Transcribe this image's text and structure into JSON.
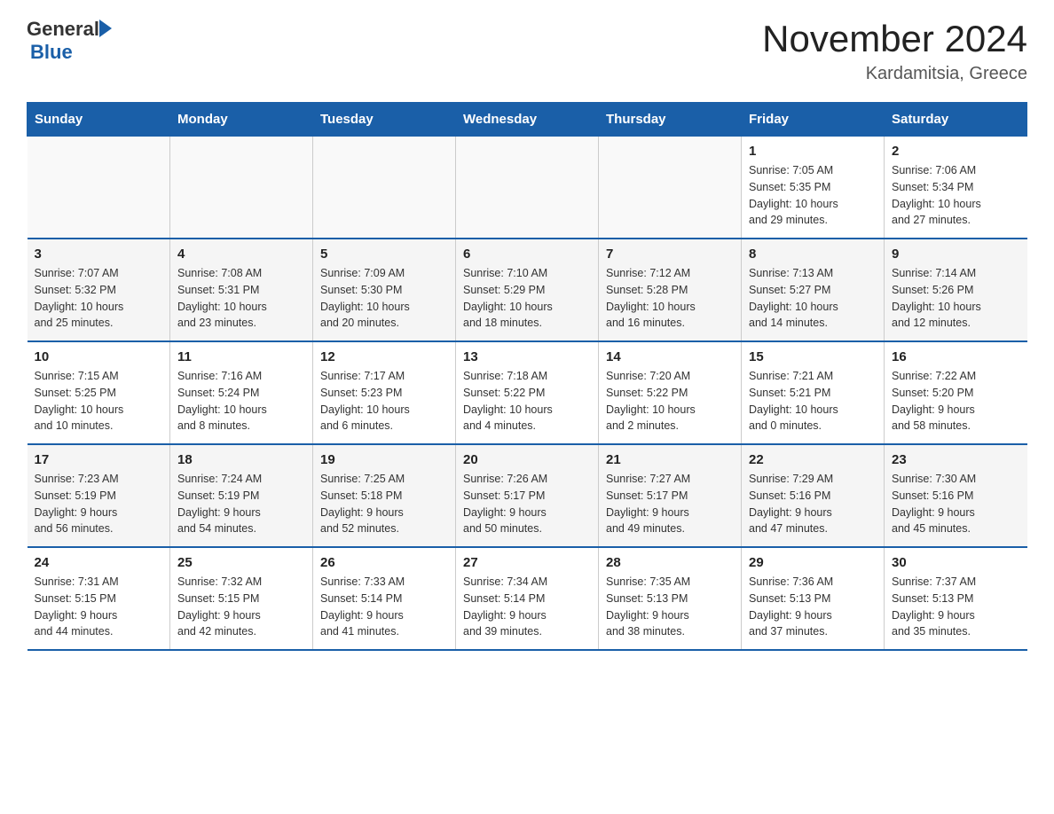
{
  "header": {
    "logo_general": "General",
    "logo_blue": "Blue",
    "title": "November 2024",
    "subtitle": "Kardamitsia, Greece"
  },
  "weekdays": [
    "Sunday",
    "Monday",
    "Tuesday",
    "Wednesday",
    "Thursday",
    "Friday",
    "Saturday"
  ],
  "weeks": [
    [
      {
        "day": "",
        "info": ""
      },
      {
        "day": "",
        "info": ""
      },
      {
        "day": "",
        "info": ""
      },
      {
        "day": "",
        "info": ""
      },
      {
        "day": "",
        "info": ""
      },
      {
        "day": "1",
        "info": "Sunrise: 7:05 AM\nSunset: 5:35 PM\nDaylight: 10 hours\nand 29 minutes."
      },
      {
        "day": "2",
        "info": "Sunrise: 7:06 AM\nSunset: 5:34 PM\nDaylight: 10 hours\nand 27 minutes."
      }
    ],
    [
      {
        "day": "3",
        "info": "Sunrise: 7:07 AM\nSunset: 5:32 PM\nDaylight: 10 hours\nand 25 minutes."
      },
      {
        "day": "4",
        "info": "Sunrise: 7:08 AM\nSunset: 5:31 PM\nDaylight: 10 hours\nand 23 minutes."
      },
      {
        "day": "5",
        "info": "Sunrise: 7:09 AM\nSunset: 5:30 PM\nDaylight: 10 hours\nand 20 minutes."
      },
      {
        "day": "6",
        "info": "Sunrise: 7:10 AM\nSunset: 5:29 PM\nDaylight: 10 hours\nand 18 minutes."
      },
      {
        "day": "7",
        "info": "Sunrise: 7:12 AM\nSunset: 5:28 PM\nDaylight: 10 hours\nand 16 minutes."
      },
      {
        "day": "8",
        "info": "Sunrise: 7:13 AM\nSunset: 5:27 PM\nDaylight: 10 hours\nand 14 minutes."
      },
      {
        "day": "9",
        "info": "Sunrise: 7:14 AM\nSunset: 5:26 PM\nDaylight: 10 hours\nand 12 minutes."
      }
    ],
    [
      {
        "day": "10",
        "info": "Sunrise: 7:15 AM\nSunset: 5:25 PM\nDaylight: 10 hours\nand 10 minutes."
      },
      {
        "day": "11",
        "info": "Sunrise: 7:16 AM\nSunset: 5:24 PM\nDaylight: 10 hours\nand 8 minutes."
      },
      {
        "day": "12",
        "info": "Sunrise: 7:17 AM\nSunset: 5:23 PM\nDaylight: 10 hours\nand 6 minutes."
      },
      {
        "day": "13",
        "info": "Sunrise: 7:18 AM\nSunset: 5:22 PM\nDaylight: 10 hours\nand 4 minutes."
      },
      {
        "day": "14",
        "info": "Sunrise: 7:20 AM\nSunset: 5:22 PM\nDaylight: 10 hours\nand 2 minutes."
      },
      {
        "day": "15",
        "info": "Sunrise: 7:21 AM\nSunset: 5:21 PM\nDaylight: 10 hours\nand 0 minutes."
      },
      {
        "day": "16",
        "info": "Sunrise: 7:22 AM\nSunset: 5:20 PM\nDaylight: 9 hours\nand 58 minutes."
      }
    ],
    [
      {
        "day": "17",
        "info": "Sunrise: 7:23 AM\nSunset: 5:19 PM\nDaylight: 9 hours\nand 56 minutes."
      },
      {
        "day": "18",
        "info": "Sunrise: 7:24 AM\nSunset: 5:19 PM\nDaylight: 9 hours\nand 54 minutes."
      },
      {
        "day": "19",
        "info": "Sunrise: 7:25 AM\nSunset: 5:18 PM\nDaylight: 9 hours\nand 52 minutes."
      },
      {
        "day": "20",
        "info": "Sunrise: 7:26 AM\nSunset: 5:17 PM\nDaylight: 9 hours\nand 50 minutes."
      },
      {
        "day": "21",
        "info": "Sunrise: 7:27 AM\nSunset: 5:17 PM\nDaylight: 9 hours\nand 49 minutes."
      },
      {
        "day": "22",
        "info": "Sunrise: 7:29 AM\nSunset: 5:16 PM\nDaylight: 9 hours\nand 47 minutes."
      },
      {
        "day": "23",
        "info": "Sunrise: 7:30 AM\nSunset: 5:16 PM\nDaylight: 9 hours\nand 45 minutes."
      }
    ],
    [
      {
        "day": "24",
        "info": "Sunrise: 7:31 AM\nSunset: 5:15 PM\nDaylight: 9 hours\nand 44 minutes."
      },
      {
        "day": "25",
        "info": "Sunrise: 7:32 AM\nSunset: 5:15 PM\nDaylight: 9 hours\nand 42 minutes."
      },
      {
        "day": "26",
        "info": "Sunrise: 7:33 AM\nSunset: 5:14 PM\nDaylight: 9 hours\nand 41 minutes."
      },
      {
        "day": "27",
        "info": "Sunrise: 7:34 AM\nSunset: 5:14 PM\nDaylight: 9 hours\nand 39 minutes."
      },
      {
        "day": "28",
        "info": "Sunrise: 7:35 AM\nSunset: 5:13 PM\nDaylight: 9 hours\nand 38 minutes."
      },
      {
        "day": "29",
        "info": "Sunrise: 7:36 AM\nSunset: 5:13 PM\nDaylight: 9 hours\nand 37 minutes."
      },
      {
        "day": "30",
        "info": "Sunrise: 7:37 AM\nSunset: 5:13 PM\nDaylight: 9 hours\nand 35 minutes."
      }
    ]
  ]
}
